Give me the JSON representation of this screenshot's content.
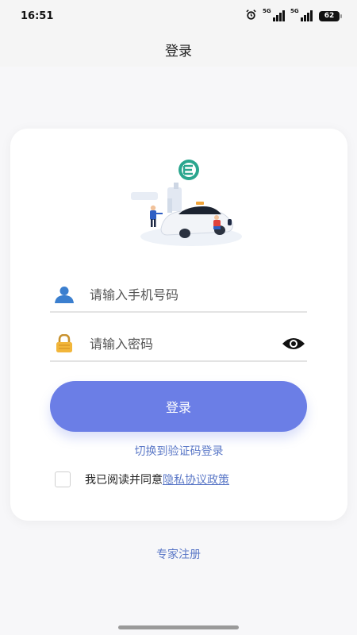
{
  "status_bar": {
    "time": "16:51",
    "signal_tag_1": "5G",
    "signal_tag_2": "5G",
    "battery_level": "62"
  },
  "header": {
    "title": "登录"
  },
  "form": {
    "phone_placeholder": "请输入手机号码",
    "password_placeholder": "请输入密码",
    "login_label": "登录",
    "switch_label": "切换到验证码登录",
    "agree_text": "我已阅读并同意",
    "policy_label": "隐私协议政策"
  },
  "footer": {
    "expert_register": "专家注册"
  },
  "colors": {
    "primary_button": "#6b7ee6",
    "link": "#5b78c7",
    "logo": "#2aa68e"
  },
  "icons": [
    "alarm-icon",
    "signal-icon",
    "battery-icon",
    "app-logo-icon",
    "user-icon",
    "lock-icon",
    "eye-icon"
  ]
}
